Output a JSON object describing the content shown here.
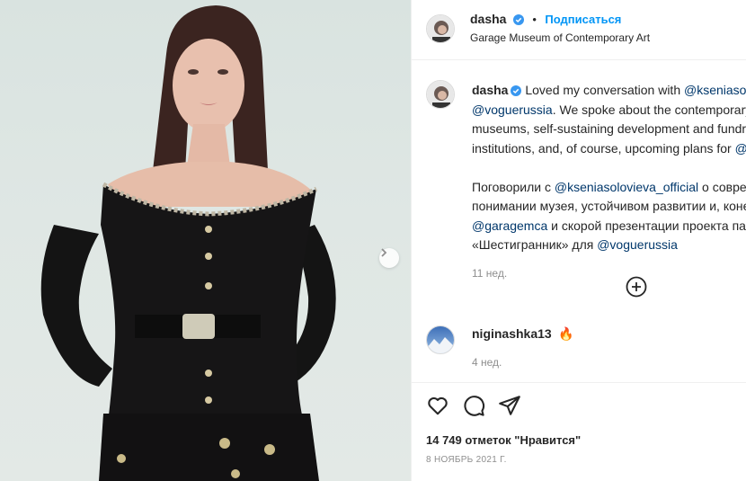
{
  "post": {
    "author": "dasha",
    "follow_label": "Подписаться",
    "location": "Garage Museum of Contemporary Art"
  },
  "caption": {
    "author": "dasha",
    "line1_text": "Loved my conversation with ",
    "line1_mention": "@ksenia​solo",
    "line2_mention": "@voguerussia",
    "line2_text": ". We spoke about the contemporary",
    "line3_text": "museums, self-sustaining development and fundra",
    "line4_text": "institutions, and, of course, upcoming plans for ",
    "line4_mention": "@",
    "ru_line1_text": "Поговорили с ",
    "ru_line1_mention": "@kseniasolovieva_official",
    "ru_line1_tail": " о соврем",
    "ru_line2_text": "понимании музея, устойчивом развитии и, конеч",
    "ru_line3_mention": "@garagemca",
    "ru_line3_text": " и скорой презентации проекта па",
    "ru_line4_text": "«Шестигранник» для ",
    "ru_line4_mention": "@voguerussia",
    "time": "11 нед."
  },
  "comment": {
    "author": "niginashka13",
    "emoji": "🔥",
    "time": "4 нед."
  },
  "stats": {
    "likes": "14 749 отметок \"Нравится\"",
    "date": "8 НОЯБРЬ 2021 Г."
  },
  "icons": {
    "verified": "verified-badge-icon",
    "next": "chevron-right-icon",
    "load_more": "plus-circle-icon",
    "like": "heart-icon",
    "comment": "comment-icon",
    "share": "paper-plane-icon",
    "fire": "fire-emoji"
  },
  "colors": {
    "accent": "#0095f6",
    "mention": "#00376b",
    "muted": "#8e8e8e",
    "verified": "#3897f0"
  }
}
